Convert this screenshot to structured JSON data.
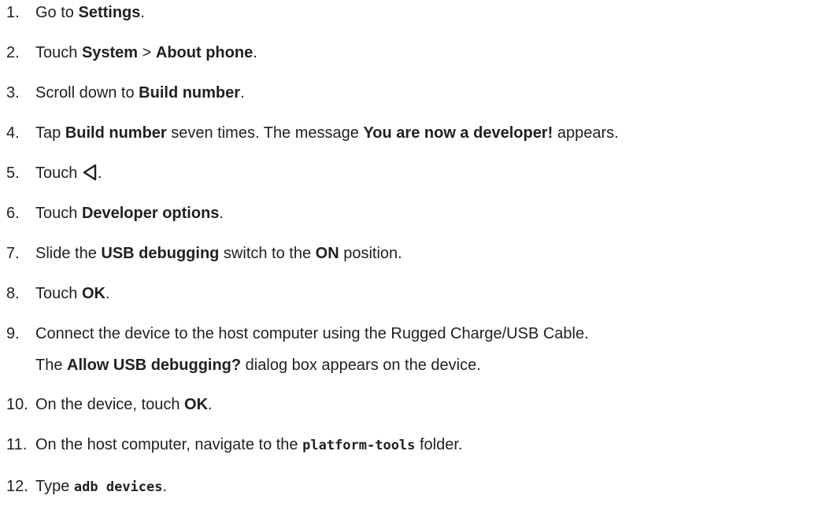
{
  "steps": [
    {
      "num": "1.",
      "parts": {
        "a": "Go to ",
        "b": "Settings",
        "c": "."
      }
    },
    {
      "num": "2.",
      "parts": {
        "a": "Touch ",
        "b": "System",
        "c": " > ",
        "d": "About phone",
        "e": "."
      }
    },
    {
      "num": "3.",
      "parts": {
        "a": "Scroll down to ",
        "b": "Build number",
        "c": "."
      }
    },
    {
      "num": "4.",
      "parts": {
        "a": "Tap ",
        "b": "Build number",
        "c": " seven times. The message ",
        "d": "You are now a developer!",
        "e": " appears."
      }
    },
    {
      "num": "5.",
      "parts": {
        "a": "Touch ",
        "icon": "back-triangle-icon",
        "c": "."
      }
    },
    {
      "num": "6.",
      "parts": {
        "a": "Touch ",
        "b": "Developer options",
        "c": "."
      }
    },
    {
      "num": "7.",
      "parts": {
        "a": "Slide the ",
        "b": "USB debugging",
        "c": " switch to the ",
        "d": "ON",
        "e": " position."
      }
    },
    {
      "num": "8.",
      "parts": {
        "a": "Touch ",
        "b": "OK",
        "c": "."
      }
    },
    {
      "num": "9.",
      "parts": {
        "a": "Connect the device to the host computer using the Rugged Charge/USB Cable."
      },
      "sub": {
        "a": "The ",
        "b": "Allow USB debugging?",
        "c": " dialog box appears on the device."
      }
    },
    {
      "num": "10.",
      "parts": {
        "a": "On the device, touch ",
        "b": "OK",
        "c": "."
      }
    },
    {
      "num": "11.",
      "parts": {
        "a": "On the host computer, navigate to the ",
        "code": "platform-tools",
        "c": " folder."
      }
    },
    {
      "num": "12.",
      "parts": {
        "a": "Type ",
        "code": "adb devices",
        "c": "."
      }
    }
  ]
}
